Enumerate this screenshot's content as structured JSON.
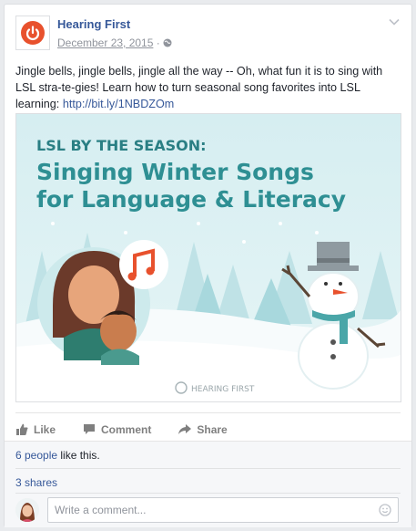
{
  "post": {
    "page_name": "Hearing First",
    "date": "December 23, 2015",
    "separator": "·",
    "text": "Jingle bells, jingle bells, jingle all the way -- Oh, what fun it is to sing with LSL stra-te-gies! Learn how to turn seasonal song favorites into LSL learning: ",
    "link": "http://bit.ly/1NBDZOm"
  },
  "image": {
    "kicker": "LSL BY THE SEASON:",
    "title_line1": "Singing Winter Songs",
    "title_line2": "for Language & Literacy",
    "watermark": "HEARING FIRST"
  },
  "actions": {
    "like": "Like",
    "comment": "Comment",
    "share": "Share"
  },
  "stats": {
    "likes_count": "6 people",
    "likes_suffix": " like this.",
    "shares": "3 shares"
  },
  "comment": {
    "placeholder": "Write a comment..."
  },
  "colors": {
    "brand_orange": "#e8512d",
    "link_blue": "#365899",
    "title_teal": "#2f8f8f"
  }
}
